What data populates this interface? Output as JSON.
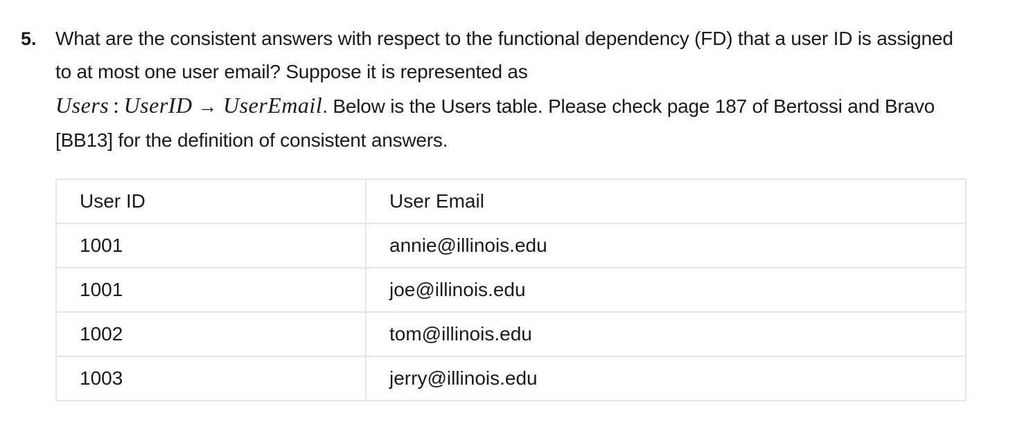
{
  "question": {
    "number": "5.",
    "text_part1": "What are the consistent answers with respect to the functional dependency (FD) that a user ID is assigned to at most one user email? Suppose it is represented as",
    "math": {
      "relation": "Users",
      "colon": ":",
      "lhs": "UserID",
      "arrow": "→",
      "rhs": "UserEmail"
    },
    "text_part2": ". Below is the Users table. Please check page 187 of Bertossi and Bravo [BB13] for the definition of consistent answers."
  },
  "table": {
    "headers": [
      "User ID",
      "User Email"
    ],
    "rows": [
      [
        "1001",
        "annie@illinois.edu"
      ],
      [
        "1001",
        "joe@illinois.edu"
      ],
      [
        "1002",
        "tom@illinois.edu"
      ],
      [
        "1003",
        "jerry@illinois.edu"
      ]
    ]
  }
}
